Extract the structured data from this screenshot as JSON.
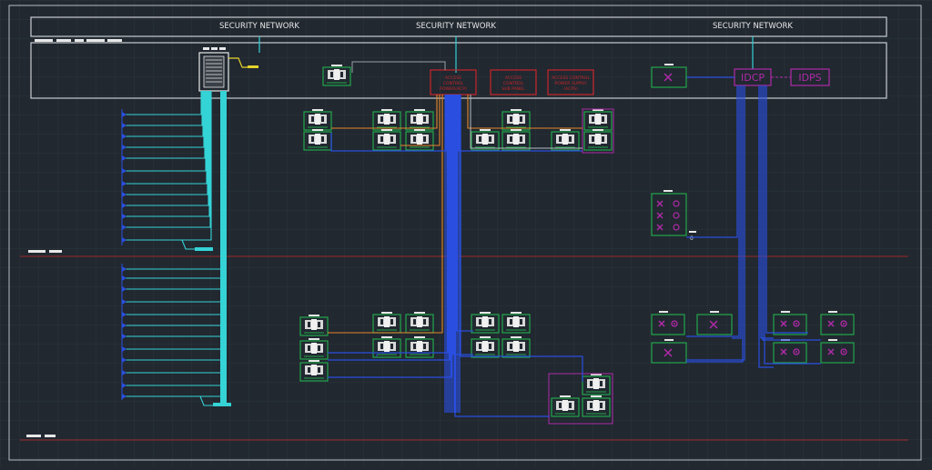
{
  "header": {
    "title_left": "SECURITY NETWORK",
    "title_center": "SECURITY NETWORK",
    "title_right": "SECURITY NETWORK"
  },
  "panels": {
    "acp1": [
      "ACCESS",
      "CONTROL",
      "POWER(ACP)"
    ],
    "acp2": [
      "ACCESS",
      "CONTROL",
      "SUB PANEL"
    ],
    "acps": [
      "ACCESS CONTROL",
      "POWER SUPPLY",
      "(ACPS)"
    ],
    "idcp": "IDCP",
    "idps": "IDPS"
  },
  "labels": {
    "zero": "0"
  },
  "colors": {
    "background": "#212830",
    "grid": "#2b333c",
    "frame": "#c9cdd2",
    "cyan": "#35d3d6",
    "blue": "#2a4fe0",
    "orange": "#e8862a",
    "red": "#c8262a",
    "magenta": "#b02aa8",
    "green": "#22a64a",
    "gray": "#9aa0a6",
    "yellow": "#e5d22a"
  }
}
